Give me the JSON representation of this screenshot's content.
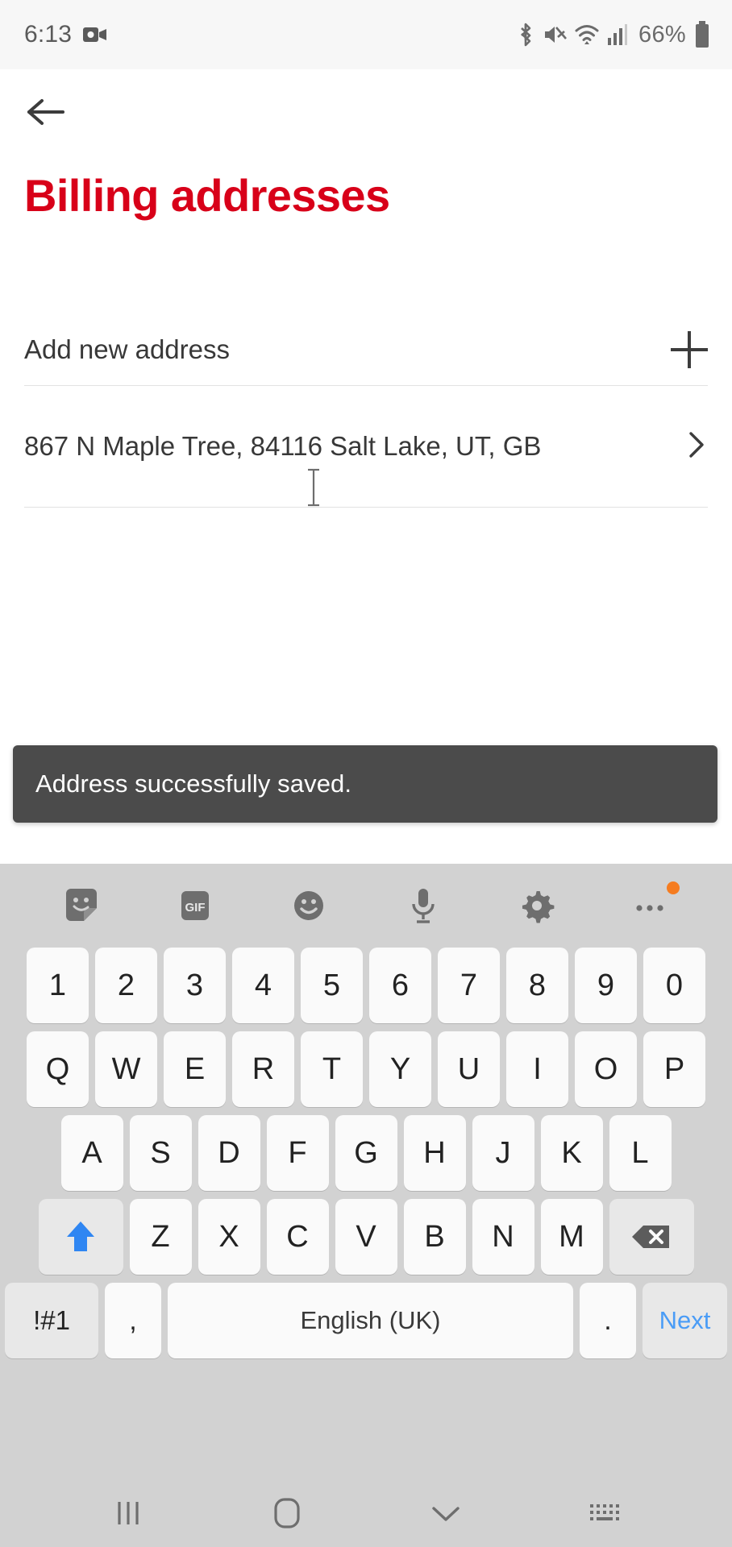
{
  "status_bar": {
    "time": "6:13",
    "battery_percent": "66%",
    "icons": [
      "video-recording-icon",
      "bluetooth-icon",
      "mute-icon",
      "wifi-icon",
      "cellular-signal-icon",
      "battery-icon"
    ]
  },
  "app": {
    "back_label": "back-arrow",
    "title": "Billing addresses"
  },
  "list": {
    "add_new": {
      "label": "Add new address",
      "action_icon": "plus-icon"
    },
    "addresses": [
      {
        "text": "867 N  Maple Tree, 84116 Salt Lake, UT, GB",
        "action_icon": "chevron-right-icon"
      }
    ]
  },
  "toast": {
    "message": "Address successfully saved.",
    "bg_color": "#4b4b4b",
    "text_color": "#ffffff"
  },
  "keyboard": {
    "toolbar": [
      {
        "name": "sticker-icon",
        "label": ""
      },
      {
        "name": "gif-icon",
        "label": "GIF"
      },
      {
        "name": "emoji-icon",
        "label": ""
      },
      {
        "name": "microphone-icon",
        "label": ""
      },
      {
        "name": "settings-gear-icon",
        "label": ""
      },
      {
        "name": "more-options-icon",
        "label": ""
      }
    ],
    "rows": {
      "numbers": [
        "1",
        "2",
        "3",
        "4",
        "5",
        "6",
        "7",
        "8",
        "9",
        "0"
      ],
      "top": [
        "Q",
        "W",
        "E",
        "R",
        "T",
        "Y",
        "U",
        "I",
        "O",
        "P"
      ],
      "home": [
        "A",
        "S",
        "D",
        "F",
        "G",
        "H",
        "J",
        "K",
        "L"
      ],
      "bottom": [
        "Z",
        "X",
        "C",
        "V",
        "B",
        "N",
        "M"
      ]
    },
    "shift_key": "shift-icon",
    "backspace_key": "backspace-icon",
    "symbols_key": "!#1",
    "comma_key": ",",
    "space_key": "English (UK)",
    "period_key": ".",
    "enter_key": "Next",
    "accent_color": "#4a9cf6"
  },
  "nav_bar": {
    "items": [
      "recents-icon",
      "home-icon",
      "hide-keyboard-icon",
      "keyboard-switch-icon"
    ]
  },
  "theme": {
    "brand_red": "#d80019",
    "keyboard_bg": "#d2d2d2",
    "key_bg": "#fafafa"
  }
}
